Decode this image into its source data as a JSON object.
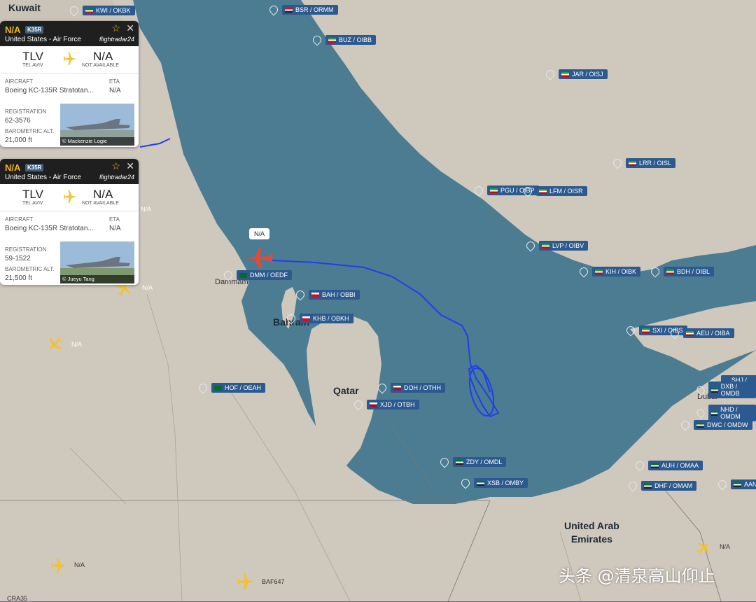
{
  "map": {
    "country_labels": [
      {
        "id": "kuwait",
        "text": "Kuwait"
      },
      {
        "id": "bahrain",
        "text": "Bahrain"
      },
      {
        "id": "qatar",
        "text": "Qatar"
      },
      {
        "id": "uae",
        "text": "United Arab\nEmirates"
      }
    ],
    "city_labels": [
      {
        "id": "dammam",
        "text": "Dammam"
      },
      {
        "id": "dubai",
        "text": "Dubai"
      }
    ],
    "airports": [
      {
        "id": "ap-kwi",
        "code": "KWI / OKBK",
        "flag": "kw"
      },
      {
        "id": "ap-bsr",
        "code": "BSR / ORMM",
        "flag": "iq"
      },
      {
        "id": "ap-buz",
        "code": "BUZ / OIBB",
        "flag": "ir"
      },
      {
        "id": "ap-jar",
        "code": "JAR / OISJ",
        "flag": "ir"
      },
      {
        "id": "ap-lrr",
        "code": "LRR / OISL",
        "flag": "ir"
      },
      {
        "id": "ap-pgu",
        "code": "PGU / OIBP",
        "flag": "ir"
      },
      {
        "id": "ap-lfm",
        "code": "LFM / OISR",
        "flag": "ir"
      },
      {
        "id": "ap-lvp",
        "code": "LVP / OIBV",
        "flag": "ir"
      },
      {
        "id": "ap-kih",
        "code": "KIH / OIBK",
        "flag": "ir"
      },
      {
        "id": "ap-bdh",
        "code": "BDH / OIBL",
        "flag": "ir"
      },
      {
        "id": "ap-dmm",
        "code": "DMM / OEDF",
        "flag": "sa"
      },
      {
        "id": "ap-bah",
        "code": "BAH / OBBI",
        "flag": "bh"
      },
      {
        "id": "ap-khb",
        "code": "KHB / OBKH",
        "flag": "bh"
      },
      {
        "id": "ap-hof",
        "code": "HOF / OEAH",
        "flag": "sa"
      },
      {
        "id": "ap-doh",
        "code": "DOH / OTHH",
        "flag": "qa"
      },
      {
        "id": "ap-xjd",
        "code": "XJD / OTBH",
        "flag": "qa"
      },
      {
        "id": "ap-sxi",
        "code": "SXI / OIBS",
        "flag": "ir"
      },
      {
        "id": "ap-aeu",
        "code": "AEU / OIBA",
        "flag": "ir"
      },
      {
        "id": "ap-shj",
        "code": "SHJ / OMSJ",
        "flag": "ae"
      },
      {
        "id": "ap-dxb",
        "code": "DXB / OMDB",
        "flag": "ae"
      },
      {
        "id": "ap-nhd",
        "code": "NHD / OMDM",
        "flag": "ae"
      },
      {
        "id": "ap-dwc",
        "code": "DWC / OMDW",
        "flag": "ae"
      },
      {
        "id": "ap-zdy",
        "code": "ZDY / OMDL",
        "flag": "ae"
      },
      {
        "id": "ap-xsb",
        "code": "XSB / OMBY",
        "flag": "ae"
      },
      {
        "id": "ap-auh",
        "code": "AUH / OMAA",
        "flag": "ae"
      },
      {
        "id": "ap-dhf",
        "code": "DHF / OMAM",
        "flag": "ae"
      },
      {
        "id": "ap-aan",
        "code": "AAN",
        "flag": "ae"
      }
    ],
    "aircraft_labels": [
      {
        "id": "pl-1",
        "text": "N/A"
      },
      {
        "id": "pl-2",
        "text": "N/A"
      },
      {
        "id": "pl-3",
        "text": "N/A"
      },
      {
        "id": "pl-4",
        "text": "N/A"
      },
      {
        "id": "pl-5",
        "text": "N/A"
      },
      {
        "id": "pl-6",
        "text": "BAF647"
      },
      {
        "id": "pl-7",
        "text": "N/A"
      }
    ],
    "selected_callout": "N/A",
    "footer_left": "CRA35"
  },
  "flight_cards": [
    {
      "callsign": "N/A",
      "type_code": "K35R",
      "operator": "United States - Air Force",
      "brand": "flightradar24",
      "from_code": "TLV",
      "from_name": "TEL AVIV",
      "to_code": "N/A",
      "to_name": "NOT AVAILABLE",
      "aircraft_label": "AIRCRAFT",
      "aircraft": "Boeing KC-135R Stratotan...",
      "eta_label": "ETA",
      "eta": "N/A",
      "reg_label": "REGISTRATION",
      "registration": "62-3576",
      "alt_label": "BAROMETRIC ALT.",
      "altitude": "21,000 ft",
      "photo_credit": "© Mackenzie Logie"
    },
    {
      "callsign": "N/A",
      "type_code": "K35R",
      "operator": "United States - Air Force",
      "brand": "flightradar24",
      "from_code": "TLV",
      "from_name": "TEL AVIV",
      "to_code": "N/A",
      "to_name": "NOT AVAILABLE",
      "aircraft_label": "AIRCRAFT",
      "aircraft": "Boeing KC-135R Stratotan...",
      "eta_label": "ETA",
      "eta": "N/A",
      "reg_label": "REGISTRATION",
      "registration": "59-1522",
      "alt_label": "BAROMETRIC ALT.",
      "altitude": "21,500 ft",
      "photo_credit": "© Jueyu Tang"
    }
  ],
  "watermark": "头条 @清泉高山仰止",
  "colors": {
    "sea": "#4a7b90",
    "land": "#cfc8bd",
    "track": "#1e3ff0",
    "selected_plane": "#e8463a",
    "plane": "#f2c230",
    "airport_tag": "#2d5a8e"
  }
}
